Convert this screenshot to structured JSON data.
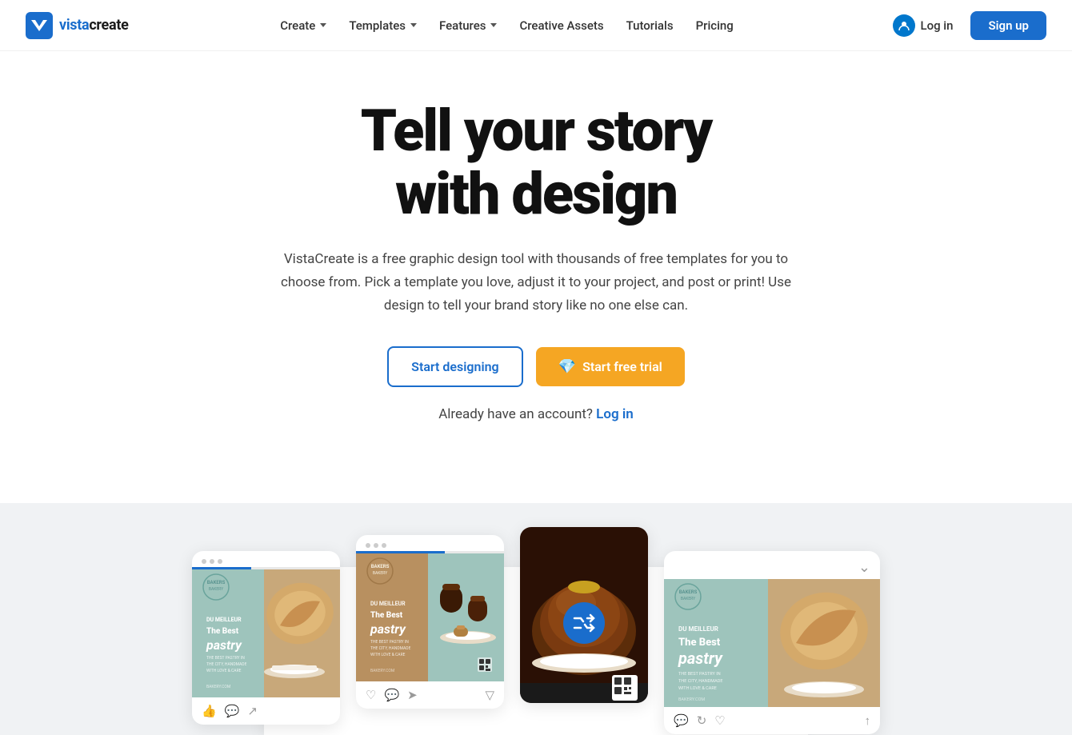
{
  "logo": {
    "text_vista": "vista",
    "text_create": "create",
    "alt": "VistaCreate"
  },
  "nav": {
    "links": [
      {
        "label": "Create",
        "has_dropdown": true
      },
      {
        "label": "Templates",
        "has_dropdown": true
      },
      {
        "label": "Features",
        "has_dropdown": true
      },
      {
        "label": "Creative Assets",
        "has_dropdown": false
      },
      {
        "label": "Tutorials",
        "has_dropdown": false
      },
      {
        "label": "Pricing",
        "has_dropdown": false
      }
    ],
    "login_label": "Log in",
    "signup_label": "Sign up"
  },
  "hero": {
    "headline_line1": "Tell your story",
    "headline_line2": "with design",
    "description": "VistaCreate is a free graphic design tool with thousands of free templates for you to choose from. Pick a template you love, adjust it to your project, and post or print! Use design to tell your brand story like no one else can.",
    "btn_start_designing": "Start designing",
    "btn_free_trial": "Start free trial",
    "already_account": "Already have an account?",
    "login_link": "Log in"
  },
  "preview": {
    "cards": [
      {
        "type": "teal",
        "dots": 3,
        "progress": 40
      },
      {
        "type": "gold",
        "dots": 3,
        "progress": 60
      },
      {
        "type": "photo",
        "shuffle": true
      },
      {
        "type": "teal-wide",
        "dots": 0
      }
    ]
  },
  "colors": {
    "primary": "#1a6dcc",
    "accent": "#f5a623",
    "teal": "#9ec4bc",
    "gold": "#c8a87a"
  }
}
